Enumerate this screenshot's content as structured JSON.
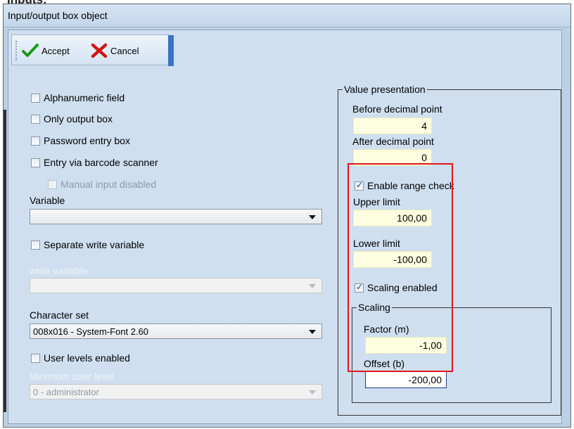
{
  "top_clip": "Inputs:",
  "window": {
    "title": "Input/output box object"
  },
  "toolbar": {
    "accept_label": "Accept",
    "cancel_label": "Cancel"
  },
  "left": {
    "alphanumeric": {
      "label": "Alphanumeric field",
      "checked": false
    },
    "only_output": {
      "label": "Only output box",
      "checked": false
    },
    "password": {
      "label": "Password entry box",
      "checked": false
    },
    "barcode": {
      "label": "Entry via barcode scanner",
      "checked": false
    },
    "manual_disabled": {
      "label": "Manual input disabled",
      "checked": false
    },
    "variable_label": "Variable",
    "variable_value": "",
    "separate_write": {
      "label": "Separate write variable",
      "checked": false
    },
    "write_variable_label": "write variable",
    "write_variable_value": "",
    "charset_label": "Character set",
    "charset_value": "008x016 - System-Font 2.60",
    "user_levels": {
      "label": "User levels enabled",
      "checked": false
    },
    "min_user_level_label": "Minimum user level",
    "min_user_level_value": "0 - administrator"
  },
  "value_presentation": {
    "title": "Value presentation",
    "before_label": "Before decimal point",
    "before_value": "4",
    "after_label": "After decimal point",
    "after_value": "0",
    "range_check": {
      "label": "Enable range check",
      "checked": true
    },
    "upper_label": "Upper limit",
    "upper_value": "100,00",
    "lower_label": "Lower limit",
    "lower_value": "-100,00",
    "scaling_enabled": {
      "label": "Scaling enabled",
      "checked": true
    },
    "scaling": {
      "title": "Scaling",
      "factor_label": "Factor (m)",
      "factor_value": "-1,00",
      "offset_label": "Offset (b)",
      "offset_value": "-200,00"
    }
  },
  "colors": {
    "highlight_border": "#e01818",
    "numeric_field_bg": "#fdfde0",
    "window_bg": "#cfdff0"
  }
}
